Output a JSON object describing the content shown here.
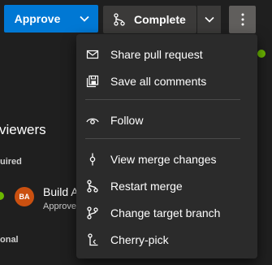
{
  "toolbar": {
    "approve_label": "Approve",
    "complete_label": "Complete",
    "colors": {
      "approve_bg": "#0078d4",
      "complete_bg": "#3b3a39",
      "more_bg": "#605e5c"
    }
  },
  "background": {
    "section_header": "viewers",
    "required_label": "uired",
    "optional_label": "onal",
    "reviewer": {
      "initials": "BA",
      "name": "Build A",
      "status": "Approve"
    }
  },
  "menu": {
    "items": [
      {
        "label": "Share pull request",
        "icon": "mail-icon"
      },
      {
        "label": "Save all comments",
        "icon": "save-all-icon"
      },
      {
        "label": "Follow",
        "icon": "eye-icon"
      },
      {
        "label": "View merge changes",
        "icon": "commit-icon"
      },
      {
        "label": "Restart merge",
        "icon": "branch-icon"
      },
      {
        "label": "Change target branch",
        "icon": "change-branch-icon"
      },
      {
        "label": "Cherry-pick",
        "icon": "cherry-pick-icon"
      }
    ]
  }
}
